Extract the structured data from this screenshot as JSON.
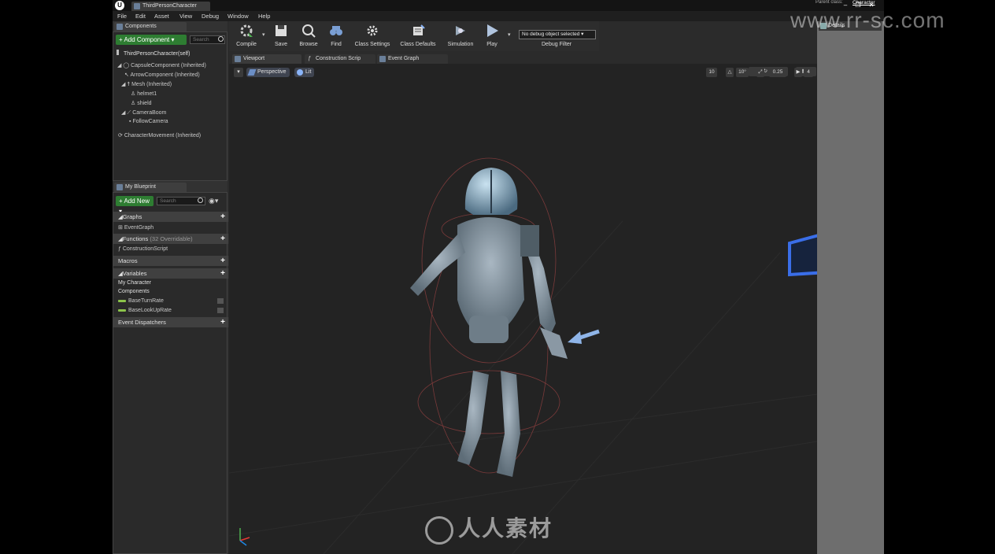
{
  "window": {
    "tab_title": "ThirdPersonCharacter",
    "parent_class_label": "Parent class:",
    "parent_class_value": "Character"
  },
  "menu": [
    "File",
    "Edit",
    "Asset",
    "View",
    "Debug",
    "Window",
    "Help"
  ],
  "components_panel": {
    "tab_label": "Components",
    "add_button": "+ Add Component ▾",
    "search_placeholder": "Search",
    "self_item": "ThirdPersonCharacter(self)",
    "tree": [
      {
        "label": "CapsuleComponent (Inherited)",
        "depth": 0
      },
      {
        "label": "ArrowComponent (Inherited)",
        "depth": 1
      },
      {
        "label": "Mesh (Inherited)",
        "depth": 1
      },
      {
        "label": "helmet1",
        "depth": 2
      },
      {
        "label": "shield",
        "depth": 2
      },
      {
        "label": "CameraBoom",
        "depth": 1
      },
      {
        "label": "FollowCamera",
        "depth": 2
      },
      {
        "label": "CharacterMovement (Inherited)",
        "depth": 0
      }
    ]
  },
  "my_blueprint": {
    "tab_label": "My Blueprint",
    "add_button": "+ Add New ▾",
    "search_placeholder": "Search",
    "sections": {
      "graphs": "Graphs",
      "event_graph": "EventGraph",
      "functions": "Functions",
      "functions_overridable": "(32 Overridable)",
      "construction_script": "ConstructionScript",
      "macros": "Macros",
      "variables": "Variables",
      "my_character": "My Character",
      "components": "Components",
      "var_1": "BaseTurnRate",
      "var_2": "BaseLookUpRate",
      "event_dispatchers": "Event Dispatchers"
    }
  },
  "toolbar": {
    "compile": "Compile",
    "save": "Save",
    "browse": "Browse",
    "find": "Find",
    "class_settings": "Class Settings",
    "class_defaults": "Class Defaults",
    "simulation": "Simulation",
    "play": "Play",
    "debug_select": "No debug object selected ▾",
    "debug_filter": "Debug Filter"
  },
  "editor_tabs": [
    "Viewport",
    "Construction Scrip",
    "Event Graph"
  ],
  "viewport": {
    "perspective": "Perspective",
    "lit": "Lit",
    "grid_snap": "10",
    "rotation_snap": "10°",
    "scale_snap": "0.25",
    "camera_speed": "4"
  },
  "details": {
    "tab_label": "Details"
  },
  "watermarks": {
    "center": "人人素材",
    "url": "www.rr-sc.com"
  },
  "colors": {
    "accent_green": "#2e7d32",
    "panel_bg": "#323232",
    "viewport_bg": "#232323",
    "details_bg": "#6e6e6e"
  }
}
